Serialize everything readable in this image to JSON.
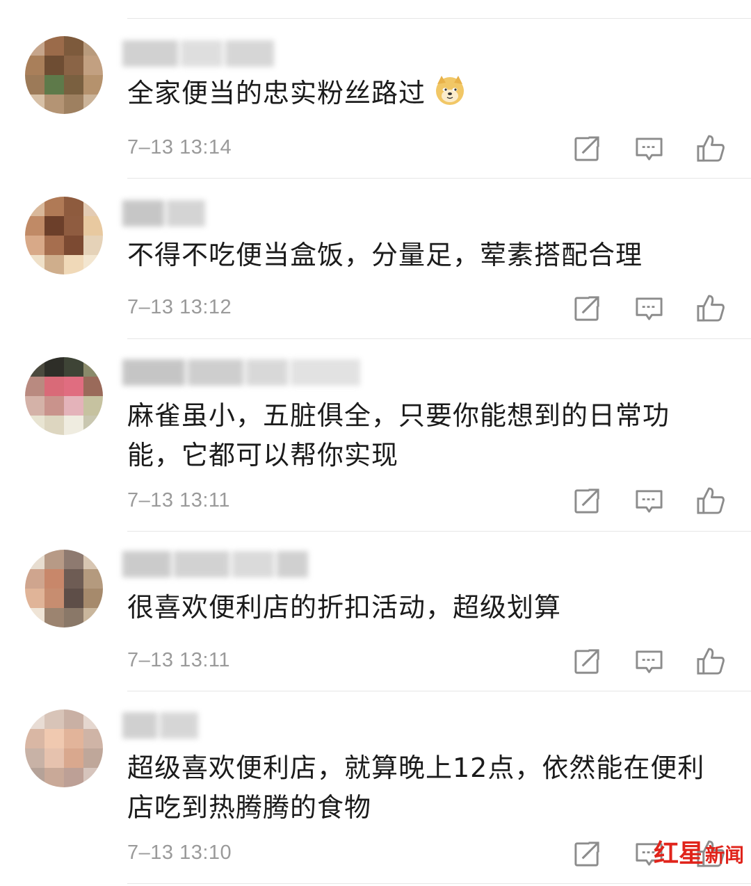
{
  "comments": [
    {
      "text": "全家便当的忠实粉丝路过",
      "emoji": "doge-emoji",
      "time": "7–13 13:14",
      "avatar_colors": [
        "#c6a58b",
        "#9b6b4a",
        "#7d5a3c",
        "#b89a7c",
        "#a97f5a",
        "#6e4d33",
        "#8a6446",
        "#c2a081",
        "#9c7a58",
        "#5e7a4a",
        "#7a6040",
        "#b5926d",
        "#d7c0a6",
        "#b49474",
        "#9e8060",
        "#cbb398"
      ]
    },
    {
      "text": "不得不吃便当盒饭，分量足，荤素搭配合理",
      "time": "7–13 13:12",
      "avatar_colors": [
        "#d9b89a",
        "#b07a56",
        "#8e5b3e",
        "#e3cbb3",
        "#c08a66",
        "#6c3f2a",
        "#8f5c40",
        "#e8c9a0",
        "#d8a988",
        "#a66e4e",
        "#7c4a32",
        "#e5d2b8",
        "#efe0c8",
        "#cfae8c",
        "#f0d9b8",
        "#f3e6d0"
      ]
    },
    {
      "text": "麻雀虽小，五脏俱全，只要你能想到的日常功能，它都可以帮你实现",
      "time": "7–13 13:11",
      "avatar_colors": [
        "#4b4a3e",
        "#2e2e28",
        "#3e4436",
        "#8a8a6a",
        "#b98a80",
        "#d96a78",
        "#e06d80",
        "#9a6a5a",
        "#d4b2a8",
        "#c9938c",
        "#e4b3ba",
        "#c6c2a0",
        "#e8e4d2",
        "#ddd6c0",
        "#efece0",
        "#c9c7b0"
      ]
    },
    {
      "text": "很喜欢便利店的折扣活动，超级划算",
      "time": "7–13 13:11",
      "avatar_colors": [
        "#e7ddd0",
        "#b79a86",
        "#8e7a70",
        "#d8c6b2",
        "#cfa58e",
        "#c8876a",
        "#6e5c54",
        "#b49a7e",
        "#e0b498",
        "#c78d70",
        "#5e4e48",
        "#a68a6c",
        "#efe4d6",
        "#9c8470",
        "#8a7868",
        "#c9b69c"
      ]
    },
    {
      "text": "超级喜欢便利店，就算晚上12点，依然能在便利店吃到热腾腾的食物",
      "time": "7–13 13:10",
      "avatar_colors": [
        "#e8dcd4",
        "#d8c4b8",
        "#c9b0a4",
        "#e5d7cf",
        "#d9b7a4",
        "#f0c9b0",
        "#e2b49a",
        "#cfb4a6",
        "#c8b2a6",
        "#e6c2ae",
        "#d9a88e",
        "#bfa79a",
        "#b5a298",
        "#c9a998",
        "#bda096",
        "#d6c4bc"
      ]
    }
  ],
  "actions": {
    "repost": "repost-icon",
    "reply": "reply-icon",
    "like": "like-icon"
  },
  "watermark": {
    "a": "红星",
    "b": "新闻"
  },
  "colors": {
    "time": "#9a9a9a",
    "icon": "#8c8c8c",
    "watermark": "#e0241b",
    "divider": "#e6e6e6"
  }
}
